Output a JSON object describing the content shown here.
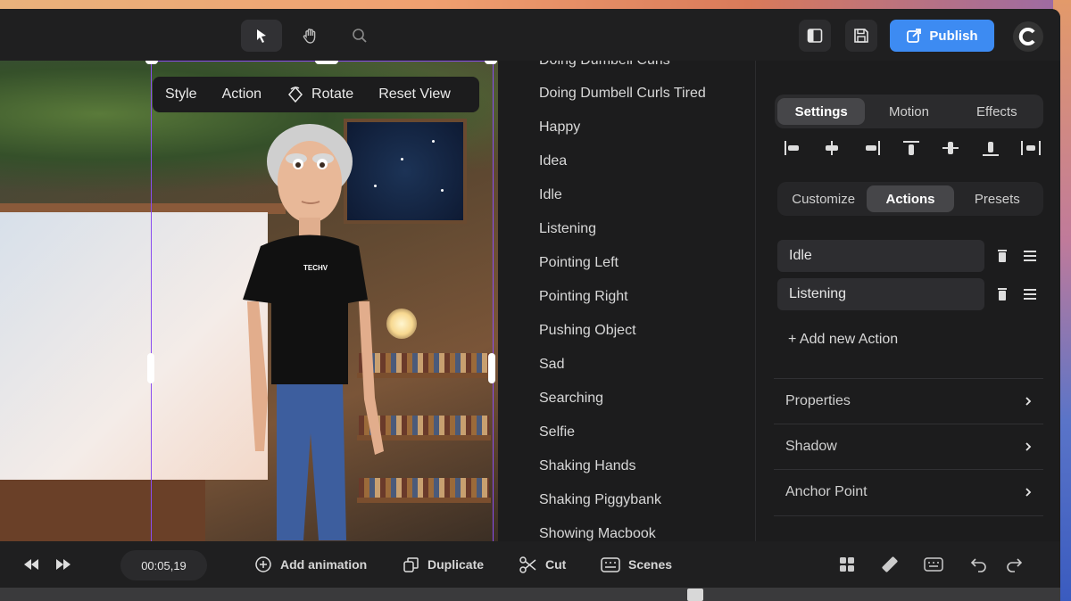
{
  "toolbar": {
    "tools": [
      "select-tool",
      "hand-tool",
      "zoom-tool"
    ],
    "publish_label": "Publish"
  },
  "canvas": {
    "context_menu": {
      "style": "Style",
      "action": "Action",
      "rotate": "Rotate",
      "reset_view": "Reset View"
    },
    "shirt_text": "TECHV"
  },
  "animations": [
    "Doing Dumbell Curls",
    "Doing Dumbell Curls Tired",
    "Happy",
    "Idea",
    "Idle",
    "Listening",
    "Pointing Left",
    "Pointing Right",
    "Pushing Object",
    "Sad",
    "Searching",
    "Selfie",
    "Shaking Hands",
    "Shaking Piggybank",
    "Showing Macbook"
  ],
  "panel": {
    "tabs": [
      "Settings",
      "Motion",
      "Effects"
    ],
    "active_tab": "Settings",
    "subtabs": [
      "Customize",
      "Actions",
      "Presets"
    ],
    "active_subtab": "Actions",
    "actions": [
      "Idle",
      "Listening"
    ],
    "add_action": "+ Add new Action",
    "sections": [
      "Properties",
      "Shadow",
      "Anchor Point"
    ]
  },
  "bottom": {
    "time": "00:05,19",
    "add_animation": "Add animation",
    "duplicate": "Duplicate",
    "cut": "Cut",
    "scenes": "Scenes"
  }
}
